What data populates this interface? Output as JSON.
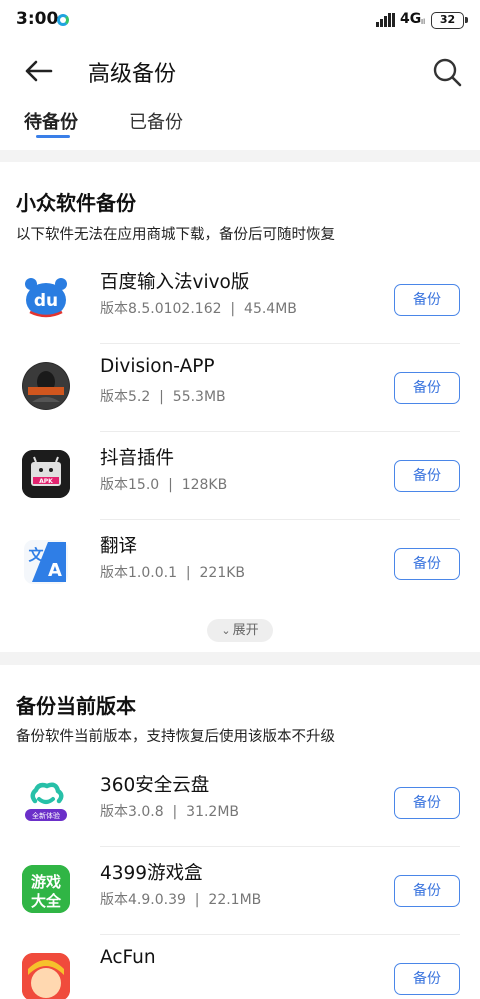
{
  "status": {
    "time": "3:00",
    "network": "4G",
    "network_sub": "Il",
    "battery": "32"
  },
  "header": {
    "title": "高级备份",
    "tabs": [
      {
        "label": "待备份",
        "active": true
      },
      {
        "label": "已备份",
        "active": false
      }
    ]
  },
  "section1": {
    "title": "小众软件备份",
    "desc": "以下软件无法在应用商城下载，备份后可随时恢复",
    "apps": [
      {
        "name": "百度输入法vivo版",
        "version": "版本8.5.0102.162",
        "size": "45.4MB",
        "button": "备份",
        "icon": "baidu-input-icon"
      },
      {
        "name": "Division-APP",
        "version": "版本5.2",
        "size": "55.3MB",
        "button": "备份",
        "icon": "division-app-icon"
      },
      {
        "name": "抖音插件",
        "version": "版本15.0",
        "size": "128KB",
        "button": "备份",
        "icon": "apk-plugin-icon"
      },
      {
        "name": "翻译",
        "version": "版本1.0.0.1",
        "size": "221KB",
        "button": "备份",
        "icon": "translate-icon"
      }
    ],
    "expand_label": "展开"
  },
  "section2": {
    "title": "备份当前版本",
    "desc": "备份软件当前版本，支持恢复后使用该版本不升级",
    "apps": [
      {
        "name": "360安全云盘",
        "version": "版本3.0.8",
        "size": "31.2MB",
        "button": "备份",
        "icon": "cloud-disk-icon"
      },
      {
        "name": "4399游戏盒",
        "version": "版本4.9.0.39",
        "size": "22.1MB",
        "button": "备份",
        "icon": "game-box-icon"
      },
      {
        "name": "AcFun",
        "version": "",
        "size": "",
        "button": "备份",
        "icon": "acfun-icon"
      }
    ]
  },
  "icons": {
    "app_icon_text_du": "du",
    "app_icon_text_apk": "APK",
    "app_icon_text_wen": "文",
    "app_icon_text_a": "A",
    "app_icon_text_quanxin": "全新体验",
    "app_icon_text_youxi": "游戏",
    "app_icon_text_daquan": "大全"
  },
  "colors": {
    "accent": "#3a7fe8",
    "button_border": "#4a86e8",
    "background": "#f3f3f3",
    "card": "#ffffff"
  }
}
